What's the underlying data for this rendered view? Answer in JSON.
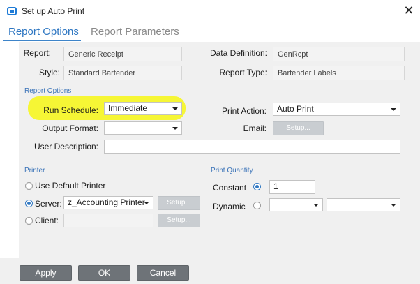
{
  "window": {
    "title": "Set up Auto Print"
  },
  "tabs": [
    {
      "label": "Report Options"
    },
    {
      "label": "Report Parameters"
    }
  ],
  "report": {
    "report_label": "Report:",
    "report_value": "Generic Receipt",
    "style_label": "Style:",
    "style_value": "Standard Bartender",
    "data_def_label": "Data Definition:",
    "data_def_value": "GenRcpt",
    "report_type_label": "Report Type:",
    "report_type_value": "Bartender Labels"
  },
  "options": {
    "section_label": "Report Options",
    "run_schedule_label": "Run Schedule:",
    "run_schedule_value": "Immediate",
    "output_format_label": "Output Format:",
    "output_format_value": "",
    "user_desc_label": "User Description:",
    "user_desc_value": "",
    "print_action_label": "Print Action:",
    "print_action_value": "Auto Print",
    "email_label": "Email:",
    "email_setup_label": "Setup..."
  },
  "printer": {
    "section_label": "Printer",
    "default_label": "Use Default Printer",
    "server_label": "Server:",
    "server_value": "z_Accounting Printer",
    "server_setup_label": "Setup...",
    "client_label": "Client:",
    "client_value": "",
    "client_setup_label": "Setup..."
  },
  "quantity": {
    "section_label": "Print Quantity",
    "constant_label": "Constant",
    "constant_value": "1",
    "dynamic_label": "Dynamic"
  },
  "footer": {
    "apply_label": "Apply",
    "ok_label": "OK",
    "cancel_label": "Cancel"
  },
  "colors": {
    "accent": "#2f77c2",
    "highlight": "#f6f62a",
    "button": "#6e7378"
  }
}
